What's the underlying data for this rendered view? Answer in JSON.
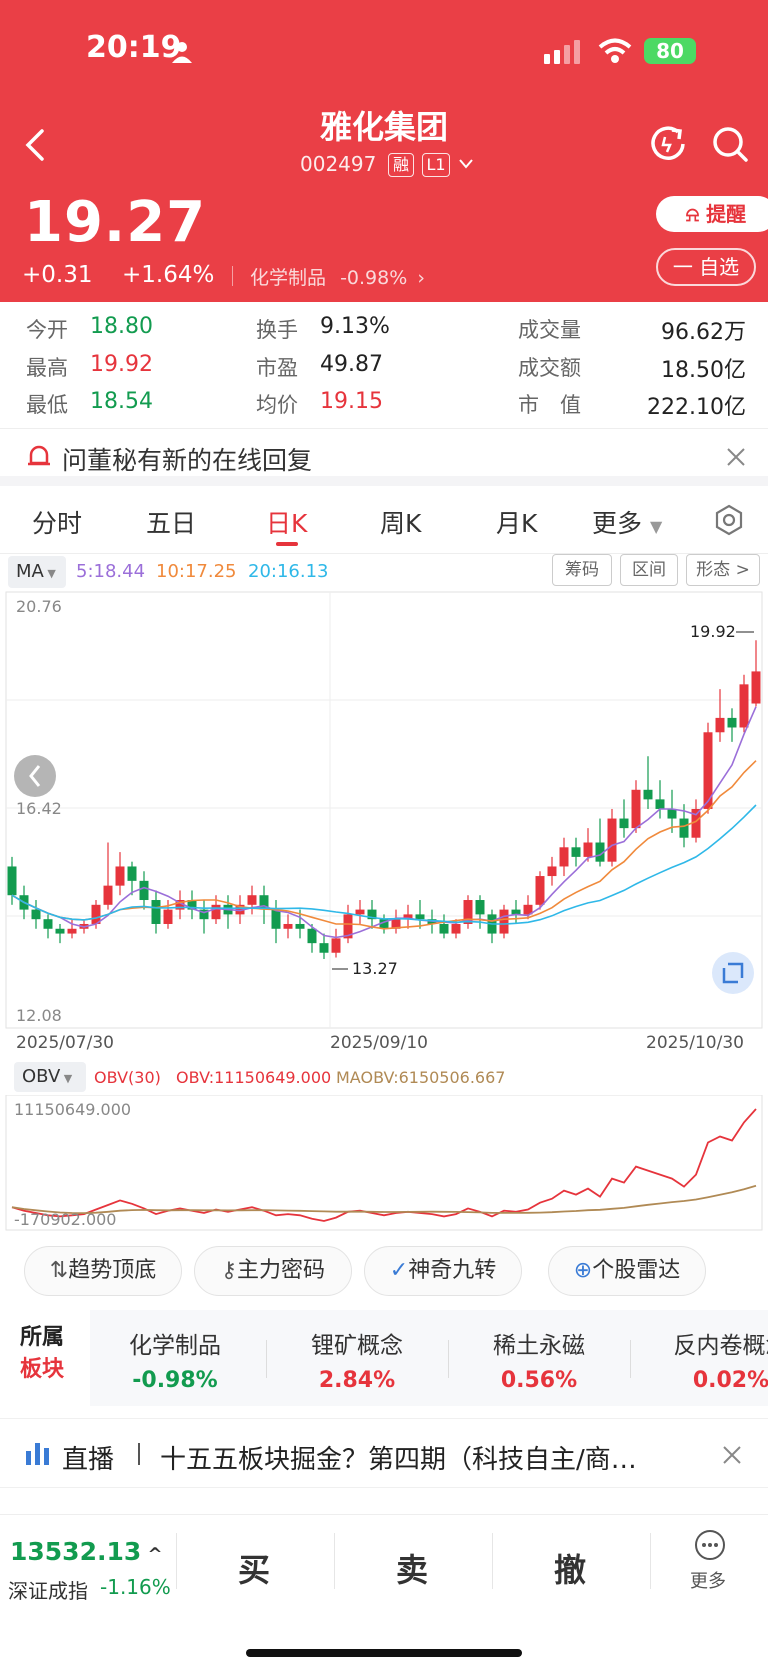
{
  "status": {
    "time": "20:19",
    "battery": "80"
  },
  "stock": {
    "name": "雅化集团",
    "code": "002497",
    "tag_margin": "融",
    "tag_level": "L1",
    "price": "19.27",
    "change": "+0.31",
    "change_pct": "+1.64%",
    "sector_name": "化学制品",
    "sector_change": "-0.98%"
  },
  "actions": {
    "alert": "提醒",
    "watchlist": "一 自选"
  },
  "quote": {
    "open_label": "今开",
    "open": "18.80",
    "high_label": "最高",
    "high": "19.92",
    "low_label": "最低",
    "low": "18.54",
    "turnover_label": "换手",
    "turnover": "9.13%",
    "pe_label": "市盈",
    "pe": "49.87",
    "avg_label": "均价",
    "avg": "19.15",
    "volume_label": "成交量",
    "volume": "96.62万",
    "amount_label": "成交额",
    "amount": "18.50亿",
    "mcap_label": "市　值",
    "mcap": "222.10亿"
  },
  "notice": {
    "text": "问董秘有新的在线回复"
  },
  "tabs": [
    "分时",
    "五日",
    "日K",
    "周K",
    "月K",
    "更多"
  ],
  "ma": {
    "label": "MA",
    "ma5": "5:18.44",
    "ma10": "10:17.25",
    "ma20": "20:16.13"
  },
  "chart_buttons": [
    "筹码",
    "区间",
    "形态 >"
  ],
  "kline": {
    "ymax_label": "20.76",
    "ymid_label": "16.42",
    "ymin_label": "12.08",
    "high_mark": "19.92",
    "low_mark": "13.27",
    "dates": [
      "2025/07/30",
      "2025/09/10",
      "2025/10/30"
    ]
  },
  "obv": {
    "label": "OBV",
    "param": "OBV(30)",
    "value": "OBV:11150649.000",
    "ma_value": "MAOBV:6150506.667",
    "top_label": "11150649.000",
    "bottom_label": "-170902.000"
  },
  "tools": [
    "趋势顶底",
    "主力密码",
    "神奇九转",
    "个股雷达"
  ],
  "sectors": {
    "title_line1": "所属",
    "title_line2": "板块",
    "items": [
      {
        "name": "化学制品",
        "pct": "-0.98%"
      },
      {
        "name": "锂矿概念",
        "pct": "2.84%"
      },
      {
        "name": "稀土永磁",
        "pct": "0.56%"
      },
      {
        "name": "反内卷概念",
        "pct": "0.02%"
      }
    ]
  },
  "live": {
    "label": "直播",
    "text": "十五五板块掘金？第四期（科技自主/商…"
  },
  "index": {
    "value": "13532.13",
    "name": "深证成指",
    "change": "-1.16%"
  },
  "trade": {
    "buy": "买",
    "sell": "卖",
    "cancel": "撤",
    "more": "更多"
  },
  "colors": {
    "header": "#ea3f46",
    "up": "#e6343c",
    "down": "#129b4f",
    "ma5": "#9b6fd9",
    "ma10": "#f08a3c",
    "ma20": "#2fb8e8"
  },
  "chart_data": {
    "type": "candlestick",
    "candles": [
      [
        15.2,
        14.6,
        15.4,
        14.4
      ],
      [
        14.6,
        14.3,
        14.8,
        14.1
      ],
      [
        14.3,
        14.1,
        14.5,
        13.9
      ],
      [
        14.1,
        13.9,
        14.2,
        13.7
      ],
      [
        13.9,
        13.8,
        14.0,
        13.6
      ],
      [
        13.8,
        13.9,
        14.1,
        13.7
      ],
      [
        13.9,
        14.0,
        14.1,
        13.8
      ],
      [
        14.0,
        14.4,
        14.5,
        13.9
      ],
      [
        14.4,
        14.8,
        15.7,
        14.3
      ],
      [
        14.8,
        15.2,
        15.5,
        14.6
      ],
      [
        15.2,
        14.9,
        15.3,
        14.6
      ],
      [
        14.9,
        14.5,
        15.1,
        14.3
      ],
      [
        14.5,
        14.0,
        14.7,
        13.8
      ],
      [
        14.0,
        14.3,
        14.5,
        13.9
      ],
      [
        14.3,
        14.5,
        14.7,
        14.1
      ],
      [
        14.5,
        14.3,
        14.7,
        14.1
      ],
      [
        14.3,
        14.1,
        14.5,
        13.8
      ],
      [
        14.1,
        14.4,
        14.6,
        14.0
      ],
      [
        14.4,
        14.2,
        14.6,
        13.9
      ],
      [
        14.2,
        14.4,
        14.6,
        14.0
      ],
      [
        14.4,
        14.6,
        14.8,
        14.2
      ],
      [
        14.6,
        14.3,
        14.8,
        14.0
      ],
      [
        14.3,
        13.9,
        14.5,
        13.6
      ],
      [
        13.9,
        14.0,
        14.2,
        13.7
      ],
      [
        14.0,
        13.9,
        14.3,
        13.7
      ],
      [
        13.9,
        13.6,
        14.0,
        13.4
      ],
      [
        13.6,
        13.4,
        13.8,
        13.27
      ],
      [
        13.4,
        13.7,
        13.9,
        13.3
      ],
      [
        13.7,
        14.2,
        14.4,
        13.6
      ],
      [
        14.2,
        14.3,
        14.5,
        14.0
      ],
      [
        14.3,
        14.1,
        14.5,
        13.9
      ],
      [
        14.1,
        13.9,
        14.2,
        13.8
      ],
      [
        13.9,
        14.1,
        14.3,
        13.8
      ],
      [
        14.1,
        14.2,
        14.4,
        13.9
      ],
      [
        14.2,
        14.1,
        14.5,
        13.9
      ],
      [
        14.1,
        14.0,
        14.3,
        13.8
      ],
      [
        14.0,
        13.8,
        14.2,
        13.7
      ],
      [
        13.8,
        14.0,
        14.1,
        13.7
      ],
      [
        14.0,
        14.5,
        14.6,
        13.9
      ],
      [
        14.5,
        14.2,
        14.6,
        13.9
      ],
      [
        14.2,
        13.8,
        14.3,
        13.6
      ],
      [
        13.8,
        14.3,
        14.4,
        13.7
      ],
      [
        14.3,
        14.2,
        14.5,
        14.0
      ],
      [
        14.2,
        14.4,
        14.6,
        14.1
      ],
      [
        14.4,
        15.0,
        15.1,
        14.3
      ],
      [
        15.0,
        15.2,
        15.4,
        14.8
      ],
      [
        15.2,
        15.6,
        15.8,
        15.0
      ],
      [
        15.6,
        15.4,
        15.8,
        15.2
      ],
      [
        15.4,
        15.7,
        16.0,
        15.3
      ],
      [
        15.7,
        15.3,
        16.2,
        15.2
      ],
      [
        15.3,
        16.2,
        16.4,
        15.2
      ],
      [
        16.2,
        16.0,
        16.6,
        15.8
      ],
      [
        16.0,
        16.8,
        17.0,
        15.9
      ],
      [
        16.8,
        16.6,
        17.5,
        16.4
      ],
      [
        16.6,
        16.4,
        17.0,
        16.2
      ],
      [
        16.4,
        16.2,
        16.8,
        15.9
      ],
      [
        16.2,
        15.8,
        16.5,
        15.6
      ],
      [
        15.8,
        16.4,
        16.6,
        15.7
      ],
      [
        16.4,
        18.0,
        18.2,
        16.3
      ],
      [
        18.0,
        18.3,
        18.9,
        17.8
      ],
      [
        18.3,
        18.1,
        18.5,
        17.8
      ],
      [
        18.1,
        19.0,
        19.2,
        18.0
      ],
      [
        18.6,
        19.27,
        19.92,
        18.54
      ]
    ]
  }
}
